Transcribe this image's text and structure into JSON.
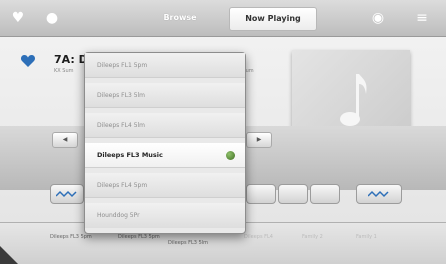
{
  "topbar": {
    "tabs": [
      {
        "label": "Browse",
        "active": false
      },
      {
        "label": "Now Playing",
        "active": true
      }
    ],
    "icons": [
      "heart-icon",
      "home-icon",
      "speaker-icon",
      "settings-icon"
    ]
  },
  "now_playing": {
    "station": "7A: D",
    "subtext_left": "KX Sum",
    "subtext_right": "ner (Hum",
    "favorite": true
  },
  "dropdown": {
    "items": [
      {
        "label": "Dileeps FL1 5pm",
        "selected": false
      },
      {
        "label": "Dileeps FL3 5lm",
        "selected": false
      },
      {
        "label": "Dileeps FL4 5lm",
        "selected": false
      },
      {
        "label": "Dileeps FL3 Music",
        "selected": true
      },
      {
        "label": "Dileeps FL4 5pm",
        "selected": false
      },
      {
        "label": "Hounddog 5Pr",
        "selected": false
      }
    ]
  },
  "bottom_labels": [
    {
      "label": "Dileeps FL3 5pm",
      "dim": false
    },
    {
      "label": "Dileeps FL3 5pm",
      "dim": false
    },
    {
      "label": "Dileeps FL3 5lm",
      "dim": false
    },
    {
      "label": "Dileeps FL4",
      "dim": true
    },
    {
      "label": "Family 2",
      "dim": true
    },
    {
      "label": "Family 1",
      "dim": true
    }
  ],
  "colors": {
    "heart": "#2d6fb8",
    "check": "#5a8f35",
    "accent_brand": "#1a6fb3"
  }
}
